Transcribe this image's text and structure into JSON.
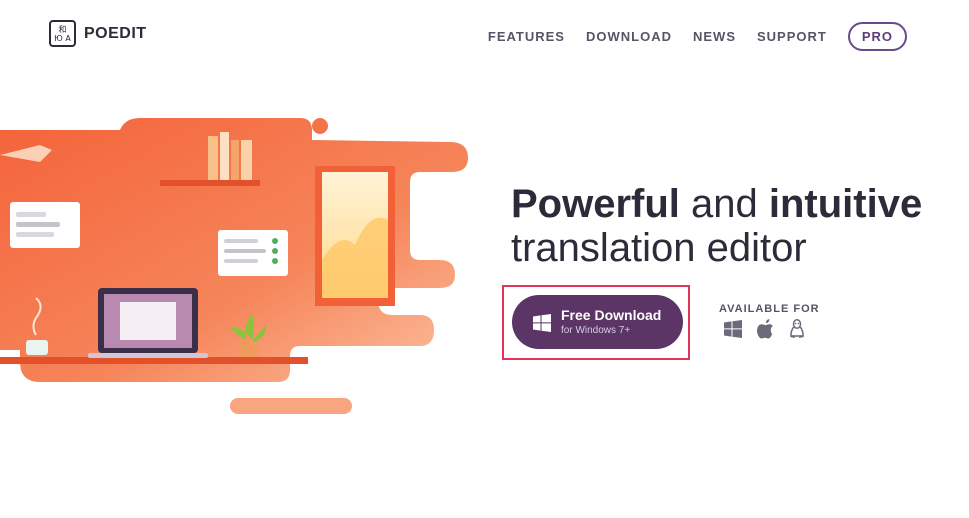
{
  "header": {
    "logo_glyph_top": "和",
    "logo_glyph_bottom": "Ю A",
    "brand": "POEDIT",
    "nav": [
      {
        "label": "FEATURES"
      },
      {
        "label": "DOWNLOAD"
      },
      {
        "label": "NEWS"
      },
      {
        "label": "SUPPORT"
      }
    ],
    "pro_label": "PRO"
  },
  "hero": {
    "headline_bold_1": "Powerful",
    "headline_mid": " and ",
    "headline_bold_2": "intuitive",
    "headline_line2": "translation editor",
    "download_button": {
      "label": "Free Download",
      "sublabel": "for Windows 7+"
    },
    "available_for_label": "AVAILABLE FOR",
    "platform_icons": [
      "windows-icon",
      "apple-icon",
      "linux-icon"
    ]
  },
  "colors": {
    "accent": "#5a3566",
    "highlight_border": "#e0365a",
    "illustration_orange": "#f26b3a"
  }
}
